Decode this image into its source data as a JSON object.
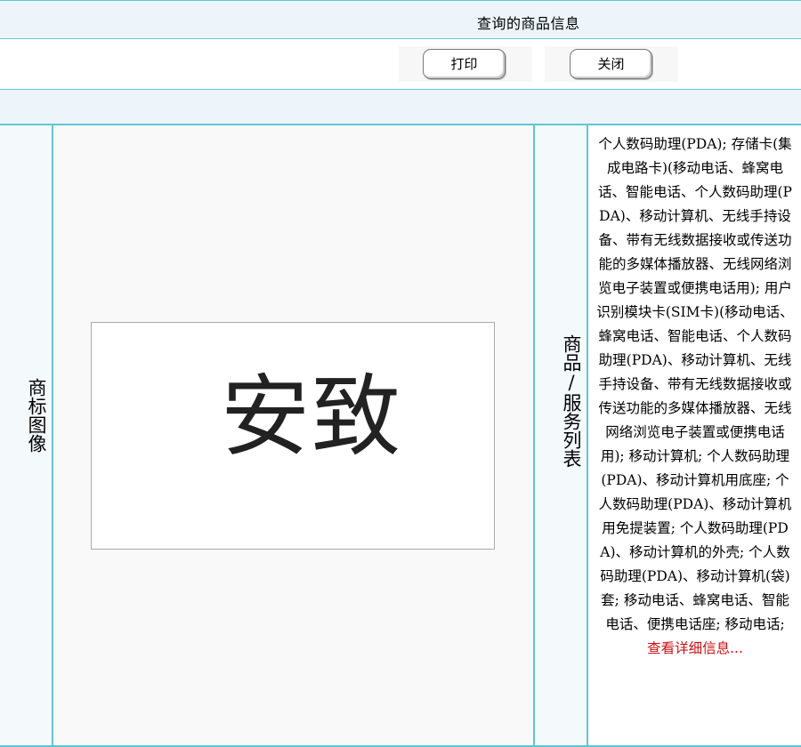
{
  "header": {
    "title": "查询的商品信息"
  },
  "toolbar": {
    "print_label": "打印",
    "close_label": "关闭"
  },
  "details": {
    "image_label": "商标图像",
    "services_label": "商品/服务列表",
    "trademark_text": "安致",
    "services_text": "个人数码助理(PDA); 存储卡(集成电路卡)(移动电话、蜂窝电话、智能电话、个人数码助理(PDA)、移动计算机、无线手持设备、带有无线数据接收或传送功能的多媒体播放器、无线网络浏览电子装置或便携电话用); 用户识别模块卡(SIM卡)(移动电话、蜂窝电话、智能电话、个人数码助理(PDA)、移动计算机、无线手持设备、带有无线数据接收或传送功能的多媒体播放器、无线网络浏览电子装置或便携电话用); 移动计算机; 个人数码助理(PDA)、移动计算机用底座; 个人数码助理(PDA)、移动计算机用免提装置; 个人数码助理(PDA)、移动计算机的外壳; 个人数码助理(PDA)、移动计算机(袋)套; 移动电话、蜂窝电话、智能电话、便携电话座; 移动电话;",
    "more_link": "查看详细信息..."
  },
  "colors": {
    "border": "#5ec7d5",
    "link": "#cc1111"
  }
}
